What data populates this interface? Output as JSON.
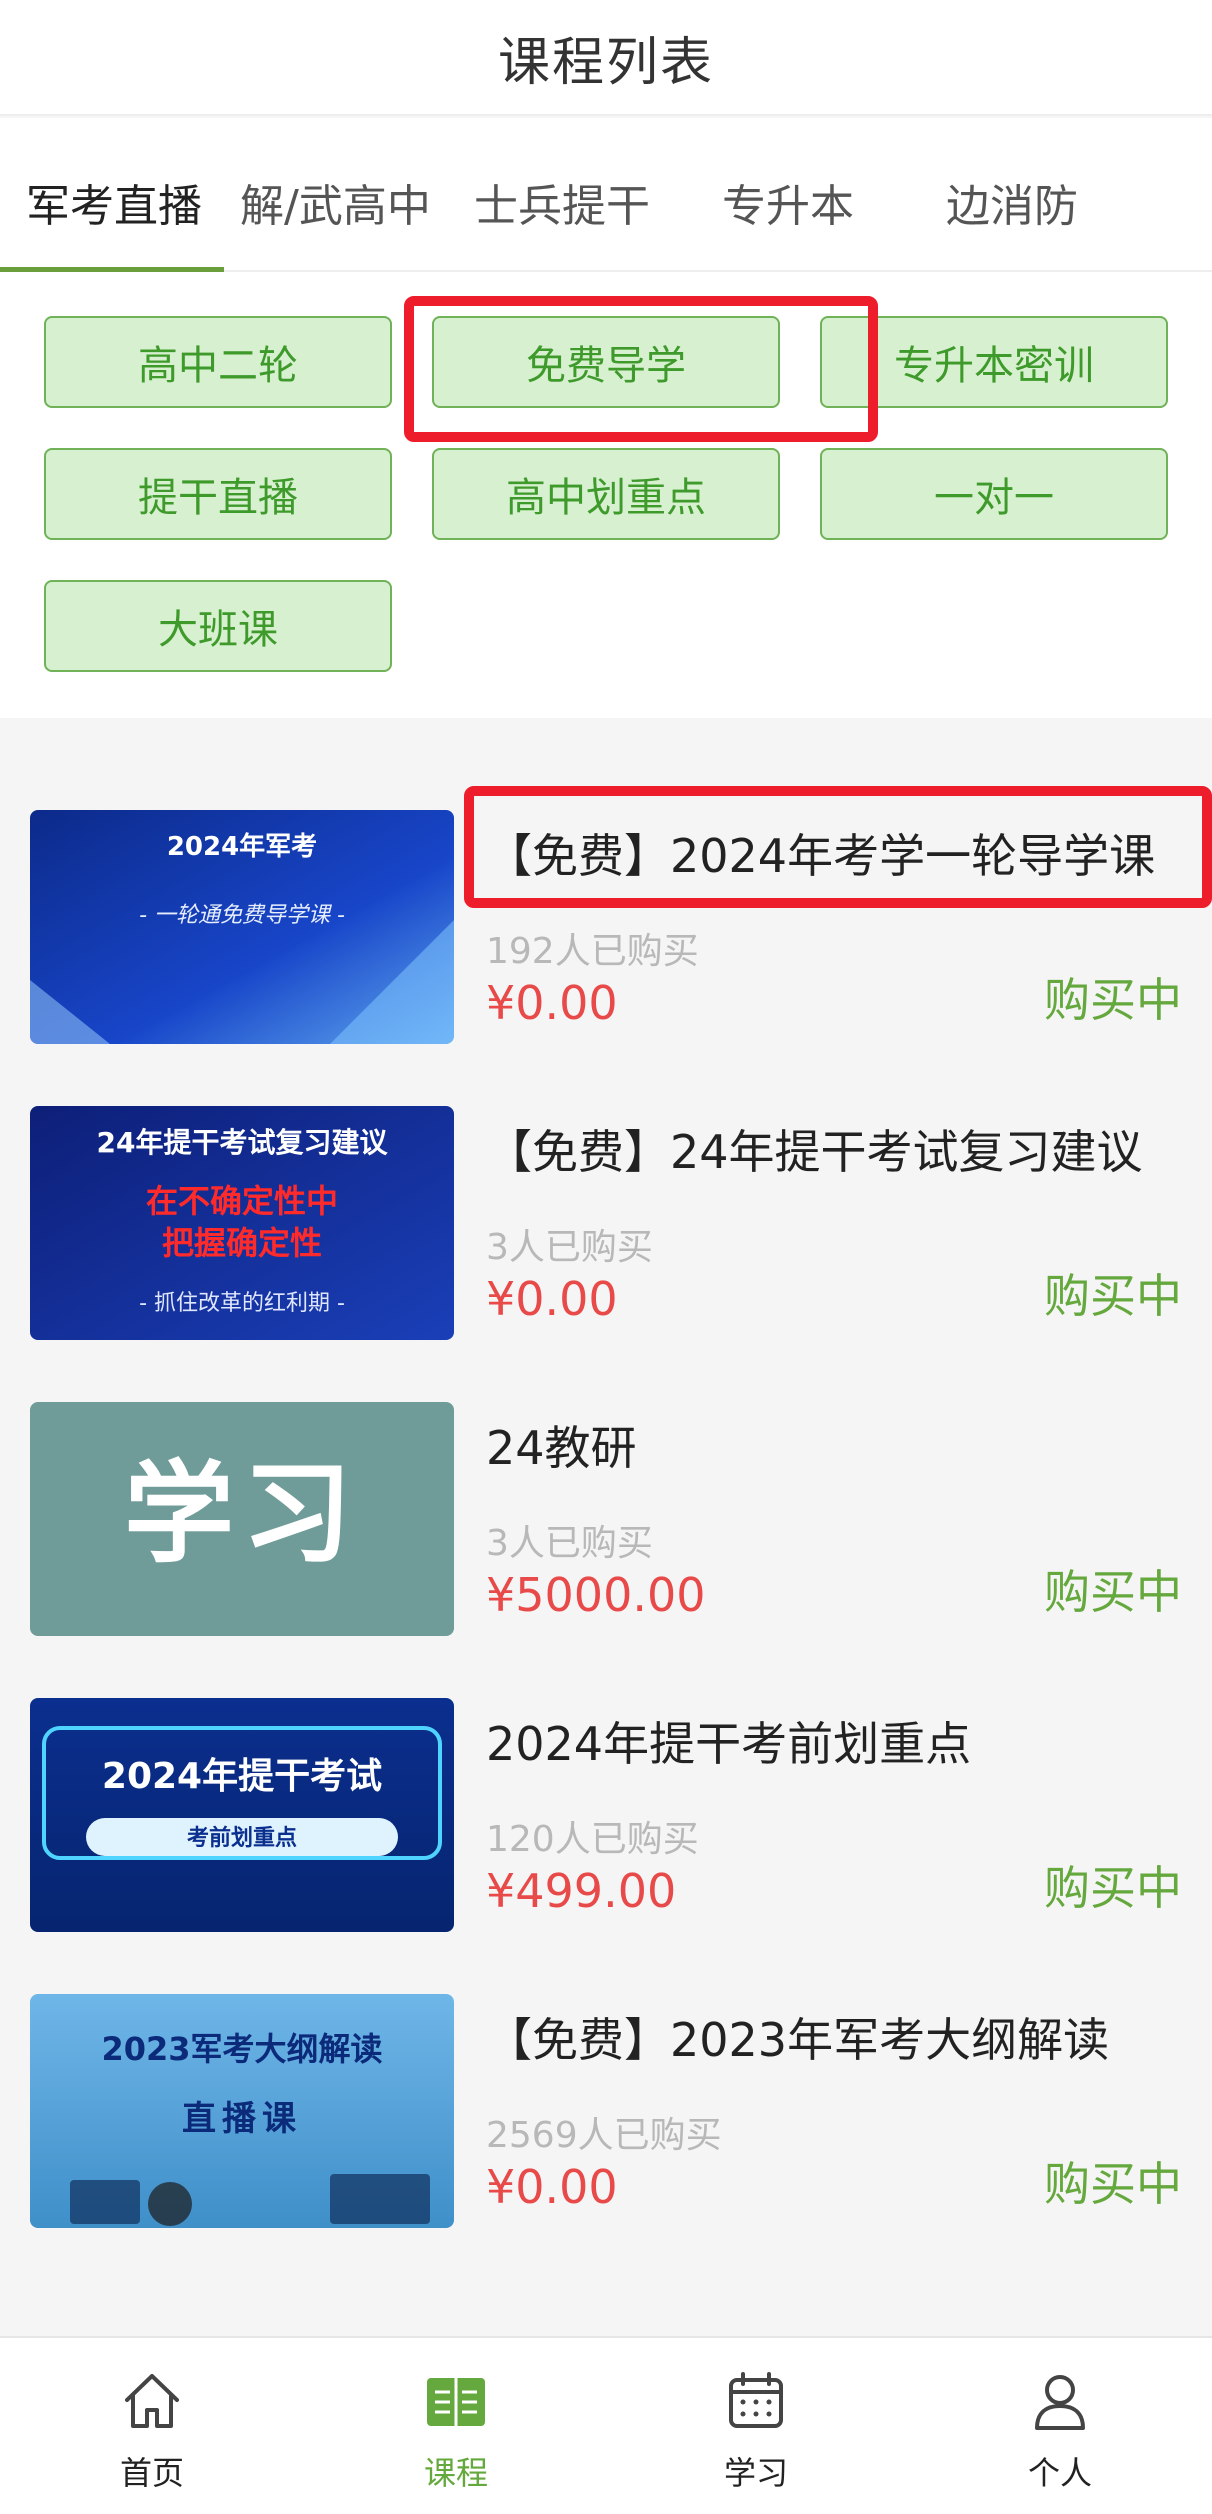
{
  "header": {
    "title": "课程列表"
  },
  "tabs": [
    {
      "label": "军考直播",
      "active": true
    },
    {
      "label": "解/武高中"
    },
    {
      "label": "士兵提干"
    },
    {
      "label": "专升本"
    },
    {
      "label": "边消防"
    }
  ],
  "filters": [
    {
      "label": "高中二轮"
    },
    {
      "label": "免费导学",
      "highlighted": true
    },
    {
      "label": "专升本密训"
    },
    {
      "label": "提干直播"
    },
    {
      "label": "高中划重点"
    },
    {
      "label": "一对一"
    },
    {
      "label": "大班课"
    }
  ],
  "courses": [
    {
      "title": "【免费】2024年考学一轮导学课",
      "buyers": "192人已购买",
      "price": "¥0.00",
      "status": "购买中",
      "thumb_line1": "2024年军考",
      "thumb_line2": "- 一轮通免费导学课 -",
      "highlighted": true
    },
    {
      "title": "【免费】24年提干考试复习建议",
      "buyers": "3人已购买",
      "price": "¥0.00",
      "status": "购买中",
      "thumb_line1": "24年提干考试复习建议",
      "thumb_line2": "在不确定性中",
      "thumb_line3": "把握确定性",
      "thumb_line4": "- 抓住改革的红利期 -"
    },
    {
      "title": "24教研",
      "buyers": "3人已购买",
      "price": "¥5000.00",
      "status": "购买中",
      "thumb_line1": "学习"
    },
    {
      "title": "2024年提干考前划重点",
      "buyers": "120人已购买",
      "price": "¥499.00",
      "status": "购买中",
      "thumb_line1": "2024年提干考试",
      "thumb_line2": "考前划重点"
    },
    {
      "title": "【免费】2023年军考大纲解读",
      "buyers": "2569人已购买",
      "price": "¥0.00",
      "status": "购买中",
      "thumb_line1": "2023军考大纲解读",
      "thumb_line2": "直播课"
    }
  ],
  "bottom_nav": [
    {
      "label": "首页",
      "icon": "home-icon"
    },
    {
      "label": "课程",
      "icon": "book-icon",
      "active": true
    },
    {
      "label": "学习",
      "icon": "calendar-icon"
    },
    {
      "label": "个人",
      "icon": "user-icon"
    }
  ],
  "colors": {
    "accent_green": "#65a83d",
    "chip_bg": "#d7f0cf",
    "price_red": "#e84949",
    "highlight_red": "#ee1d2b"
  }
}
